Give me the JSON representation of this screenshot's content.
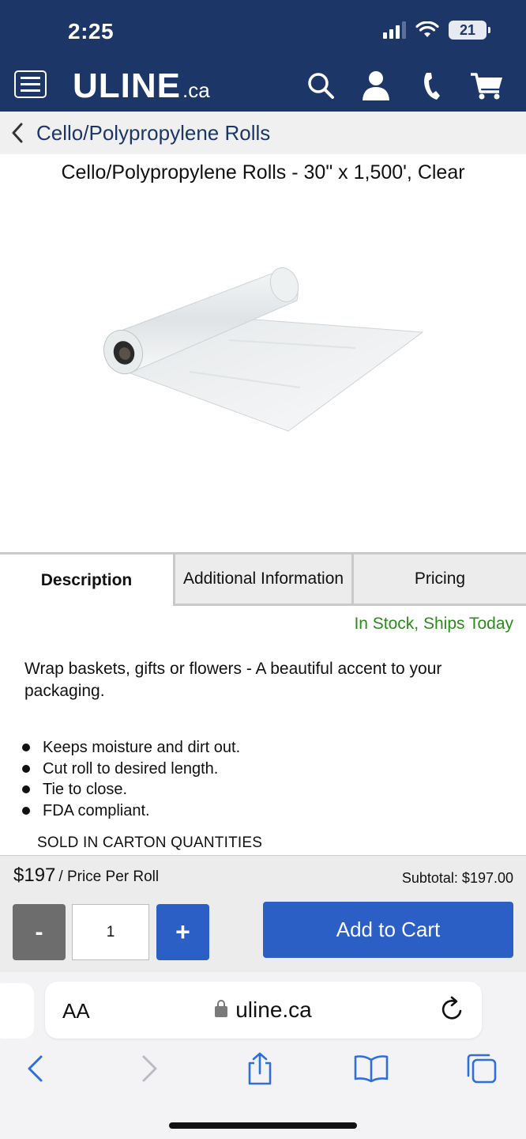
{
  "status_bar": {
    "time": "2:25",
    "battery": "21"
  },
  "header": {
    "logo_main": "ULINE",
    "logo_suffix": ".ca",
    "icons": [
      "menu-icon",
      "search-icon",
      "account-icon",
      "phone-icon",
      "cart-icon"
    ],
    "background_color": "#1c3668"
  },
  "breadcrumb": {
    "label": "Cello/Polypropylene Rolls"
  },
  "product": {
    "title": "Cello/Polypropylene Rolls - 30\" x 1,500', Clear",
    "image": "clear-film-roll"
  },
  "tabs": [
    {
      "label": "Description",
      "active": true
    },
    {
      "label": "Additional Information",
      "active": false
    },
    {
      "label": "Pricing",
      "active": false
    }
  ],
  "stock_status": "In Stock, Ships Today",
  "description": "Wrap baskets, gifts or flowers - A beautiful accent to your packaging.",
  "bullets": [
    "Keeps moisture and dirt out.",
    "Cut roll to desired length.",
    "Tie to close.",
    "FDA compliant."
  ],
  "sold_note": "SOLD IN CARTON QUANTITIES",
  "cart": {
    "price": "$197",
    "price_label": "/ Price Per Roll",
    "subtotal": "Subtotal: $197.00",
    "minus_label": "-",
    "plus_label": "+",
    "quantity": "1",
    "add_to_cart_label": "Add to Cart",
    "accent_color": "#2b5fc5"
  },
  "browser": {
    "aa_label": "AA",
    "url": "uline.ca"
  }
}
